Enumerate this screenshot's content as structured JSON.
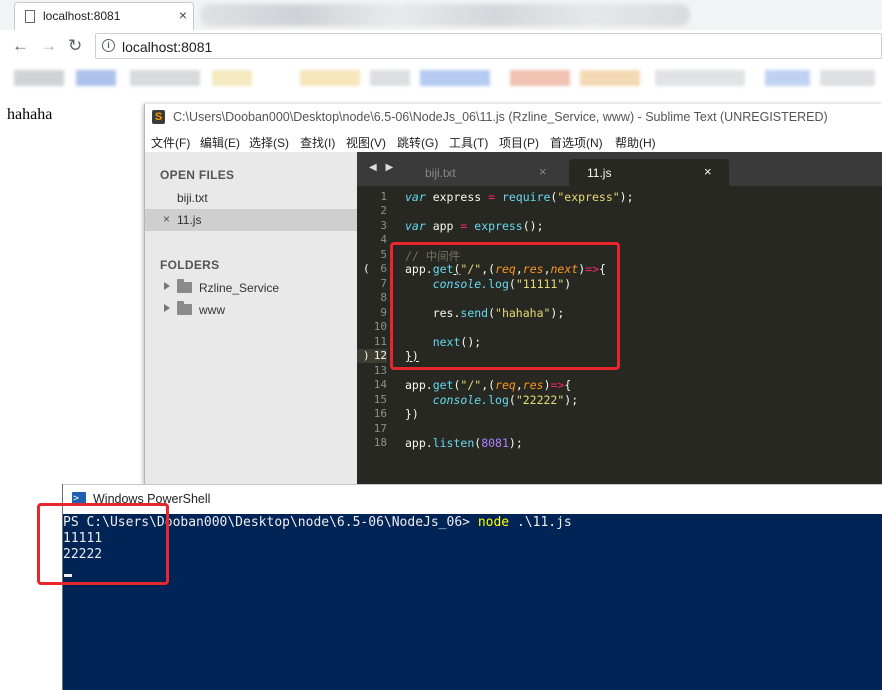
{
  "browser": {
    "tab_title": "localhost:8081",
    "tab_close": "×",
    "url": "localhost:8081",
    "page_text": "hahaha",
    "icons": [
      "document-icon",
      "back-icon",
      "forward-icon",
      "reload-icon",
      "info-icon"
    ]
  },
  "sublime": {
    "title": "C:\\Users\\Dooban000\\Desktop\\node\\6.5-06\\NodeJs_06\\11.js (Rzline_Service, www) - Sublime Text (UNREGISTERED)",
    "logo_glyph": "S",
    "menu": [
      "文件(F)",
      "编辑(E)",
      "选择(S)",
      "查找(I)",
      "视图(V)",
      "跳转(G)",
      "工具(T)",
      "项目(P)",
      "首选项(N)",
      "帮助(H)"
    ],
    "sidebar": {
      "open_files_header": "OPEN FILES",
      "open_files": [
        {
          "name": "biji.txt",
          "selected": false,
          "close": ""
        },
        {
          "name": "11.js",
          "selected": true,
          "close": "×"
        }
      ],
      "folders_header": "FOLDERS",
      "folders": [
        {
          "name": "Rzline_Service"
        },
        {
          "name": "www"
        }
      ]
    },
    "tabs": {
      "arrows": "◀ ▶",
      "items": [
        {
          "label": "biji.txt",
          "close": "×",
          "active": false
        },
        {
          "label": "11.js",
          "close": "×",
          "active": true
        }
      ]
    },
    "gutter": [
      "1",
      "2",
      "3",
      "4",
      "5",
      "6",
      "7",
      "8",
      "9",
      "10",
      "11",
      "12",
      "13",
      "14",
      "15",
      "16",
      "17",
      "18"
    ],
    "fold_open": "(",
    "fold_close": ")",
    "theme": {
      "background": "#272822",
      "keyword": "#66d9ef",
      "operator": "#f92672",
      "string": "#e6db74",
      "number": "#ae81ff",
      "param": "#fd971f",
      "comment": "#75715e"
    }
  },
  "code": {
    "l1_var": "var",
    "l1_name": " express ",
    "l1_eq": "=",
    "l1_fn": " require",
    "l1_p1": "(",
    "l1_str": "\"express\"",
    "l1_p2": ");",
    "l3_var": "var",
    "l3_name": " app ",
    "l3_eq": "=",
    "l3_fn": " express",
    "l3_rest": "();",
    "l5_cmt": "// 中间件",
    "l6_obj": "app.",
    "l6_fn": "get",
    "l6_p1": "(",
    "l6_str": "\"/\"",
    "l6_comma": ",(",
    "l6_a1": "req",
    "l6_c1": ",",
    "l6_a2": "res",
    "l6_c2": ",",
    "l6_a3": "next",
    "l6_p2": ")",
    "l6_arrow": "=>",
    "l6_brace": "{",
    "l7_obj": "    console.",
    "l7_fn": "log",
    "l7_p1": "(",
    "l7_str": "\"11111\"",
    "l7_p2": ")",
    "l9_obj": "    res.",
    "l9_fn": "send",
    "l9_p1": "(",
    "l9_str": "\"hahaha\"",
    "l9_p2": ");",
    "l11_fn": "    next",
    "l11_rest": "();",
    "l12": "})",
    "l14_obj": "app.",
    "l14_fn": "get",
    "l14_p1": "(",
    "l14_str": "\"/\"",
    "l14_comma": ",(",
    "l14_a1": "req",
    "l14_c1": ",",
    "l14_a2": "res",
    "l14_p2": ")",
    "l14_arrow": "=>",
    "l14_brace": "{",
    "l15_obj": "    console.",
    "l15_fn": "log",
    "l15_p1": "(",
    "l15_str": "\"22222\"",
    "l15_p2": ");",
    "l16": "})",
    "l18_obj": "app.",
    "l18_fn": "listen",
    "l18_p1": "(",
    "l18_num": "8081",
    "l18_p2": ");"
  },
  "powershell": {
    "title": "Windows PowerShell",
    "icon_glyph": ">_",
    "prompt": "PS C:\\Users\\Dooban000\\Desktop\\node\\6.5-06\\NodeJs_06> ",
    "command": "node",
    "args": " .\\11.js",
    "output": [
      "11111",
      "22222"
    ],
    "colors": {
      "background": "#012456",
      "text": "#eeedf0",
      "command": "#ffff00"
    }
  },
  "annotations": {
    "color": "#e8262b"
  }
}
